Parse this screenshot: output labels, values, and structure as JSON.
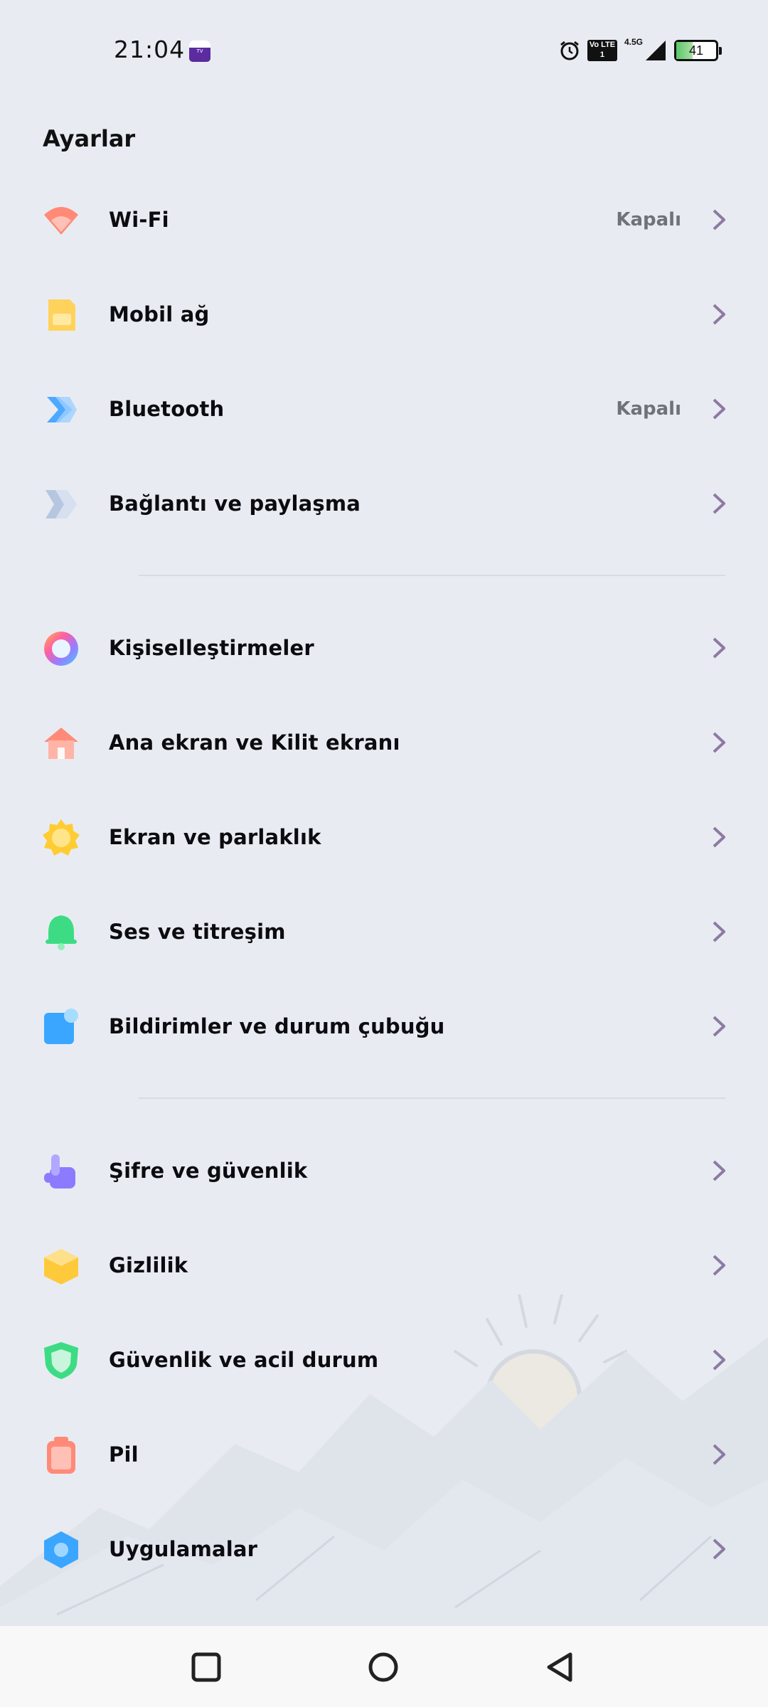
{
  "status_bar": {
    "time": "21:04",
    "app_badge": "TV",
    "volte": "Vo LTE 1",
    "network_type": "4.5G",
    "battery_level": "41",
    "battery_fraction": 0.41
  },
  "header": {
    "title": "Ayarlar"
  },
  "settings": {
    "wifi": {
      "label": "Wi-Fi",
      "value": "Kapalı",
      "icon": "wifi-icon",
      "color": "#ff8a78"
    },
    "mobile": {
      "label": "Mobil ağ",
      "icon": "sim-card-icon",
      "color": "#ffd25c"
    },
    "bluetooth": {
      "label": "Bluetooth",
      "value": "Kapalı",
      "icon": "bluetooth-icon",
      "color": "#4fa8ff"
    },
    "connection": {
      "label": "Bağlantı ve paylaşma",
      "icon": "connection-share-icon",
      "color": "#b7c6e0"
    },
    "personalization": {
      "label": "Kişiselleştirmeler",
      "icon": "palette-icon",
      "color": "#ff7fb0"
    },
    "home_lock": {
      "label": "Ana ekran ve Kilit ekranı",
      "icon": "home-icon",
      "color": "#ff8a78"
    },
    "display": {
      "label": "Ekran ve parlaklık",
      "icon": "brightness-icon",
      "color": "#ffcc33"
    },
    "sound": {
      "label": "Ses ve titreşim",
      "icon": "bell-icon",
      "color": "#3ddc84"
    },
    "notifications": {
      "label": "Bildirimler ve durum çubuğu",
      "icon": "notification-icon",
      "color": "#3aa6ff"
    },
    "password_security": {
      "label": "Şifre ve güvenlik",
      "icon": "fingerprint-hand-icon",
      "color": "#8c7bff"
    },
    "privacy": {
      "label": "Gizlilik",
      "icon": "privacy-cube-icon",
      "color": "#ffc93c"
    },
    "safety": {
      "label": "Güvenlik ve acil durum",
      "icon": "shield-icon",
      "color": "#3ddc84"
    },
    "battery": {
      "label": "Pil",
      "icon": "battery-icon",
      "color": "#ff8a78"
    },
    "apps": {
      "label": "Uygulamalar",
      "icon": "apps-hexagon-icon",
      "color": "#3aa6ff"
    }
  }
}
